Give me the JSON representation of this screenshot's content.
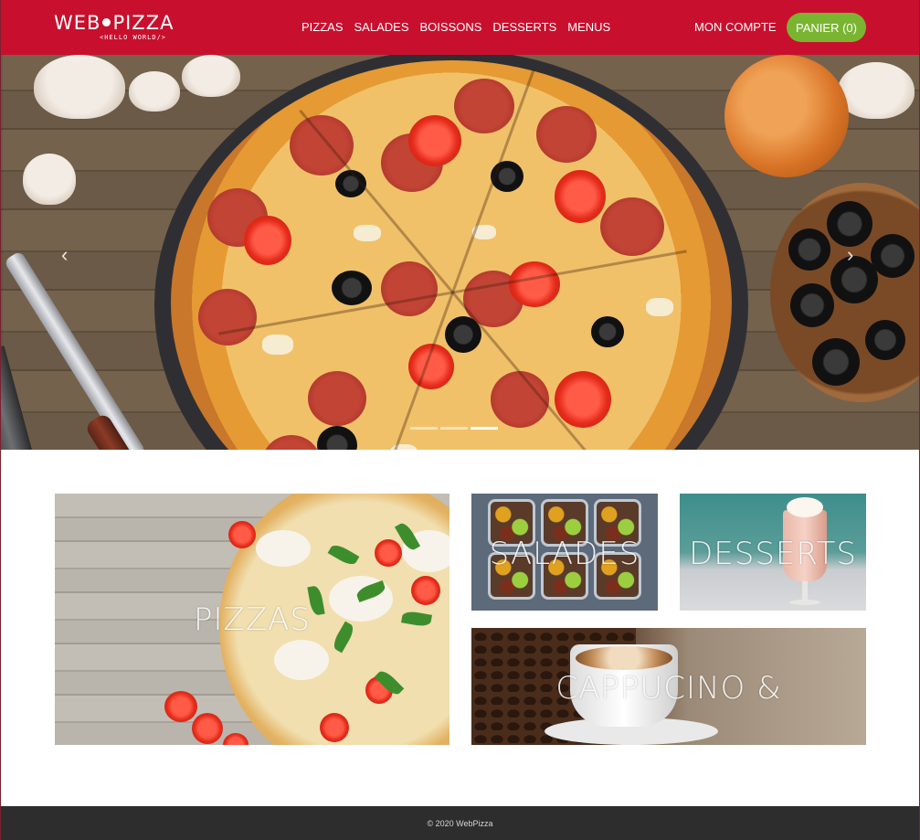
{
  "brand": {
    "name_left": "WEB",
    "name_right": "PIZZA",
    "tagline": "<HELLO WORLD/>"
  },
  "nav": {
    "items": [
      {
        "label": "PIZZAS"
      },
      {
        "label": "SALADES"
      },
      {
        "label": "BOISSONS"
      },
      {
        "label": "DESSERTS"
      },
      {
        "label": "MENUS"
      }
    ],
    "account_label": "MON COMPTE",
    "cart_label": "PANIER (0)"
  },
  "carousel": {
    "prev_icon": "chevron-left-icon",
    "next_icon": "chevron-right-icon",
    "slide_count": 3,
    "active_slide": 3
  },
  "categories": {
    "pizzas": "PIZZAS",
    "salades": "SALADES",
    "desserts": "DESSERTS",
    "cappucino": "CAPPUCINO &"
  },
  "footer": {
    "copyright": "© 2020 WebPizza"
  },
  "colors": {
    "brand_red": "#c8102e",
    "cart_green": "#7ab532",
    "footer_bg": "#2d2d2d"
  }
}
